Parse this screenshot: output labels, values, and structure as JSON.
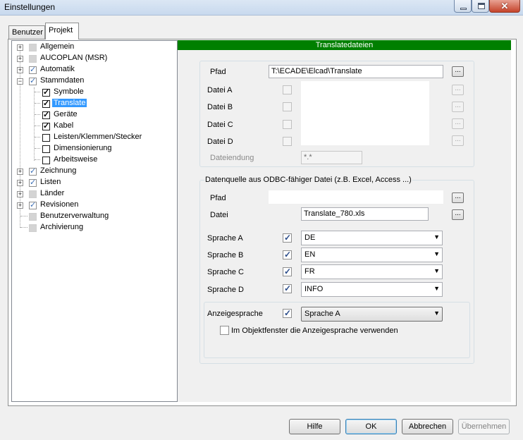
{
  "window": {
    "title": "Einstellungen",
    "close_glyph": "✕"
  },
  "tabs": [
    {
      "label": "Benutzer"
    },
    {
      "label": "Projekt"
    }
  ],
  "tree": {
    "expander_glyph": "+",
    "items": [
      {
        "label": "Allgemein"
      },
      {
        "label": "AUCOPLAN (MSR)"
      },
      {
        "label": "Automatik"
      },
      {
        "label": "Stammdaten"
      },
      {
        "label": "Symbole"
      },
      {
        "label": "Translate"
      },
      {
        "label": "Geräte"
      },
      {
        "label": "Kabel"
      },
      {
        "label": "Leisten/Klemmen/Stecker"
      },
      {
        "label": "Dimensionierung"
      },
      {
        "label": "Arbeitsweise"
      },
      {
        "label": "Zeichnung"
      },
      {
        "label": "Listen"
      },
      {
        "label": "Länder"
      },
      {
        "label": "Revisionen"
      },
      {
        "label": "Benutzerverwaltung"
      },
      {
        "label": "Archivierung"
      }
    ]
  },
  "translate": {
    "header": "Translatedateien",
    "pfad_label": "Pfad",
    "pfad_value": "T:\\ECADE\\Elcad\\Translate",
    "browse": "...",
    "datei_a": "Datei A",
    "datei_b": "Datei B",
    "datei_c": "Datei C",
    "datei_d": "Datei D",
    "dateiendung_label": "Dateiendung",
    "dateiendung_value": "*.*"
  },
  "odbc": {
    "group_title": "Datenquelle aus ODBC-fähiger Datei (z.B. Excel, Access ...)",
    "pfad_label": "Pfad",
    "pfad_value": "",
    "datei_label": "Datei",
    "datei_value": "Translate_780.xls",
    "languages": [
      {
        "label": "Sprache A",
        "value": "DE"
      },
      {
        "label": "Sprache B",
        "value": "EN"
      },
      {
        "label": "Sprache C",
        "value": "FR"
      },
      {
        "label": "Sprache D",
        "value": "INFO"
      }
    ],
    "anzeige_label": "Anzeigesprache",
    "anzeige_value": "Sprache A",
    "objektfenster_label": "Im Objektfenster die Anzeigesprache verwenden",
    "arrow_glyph": "▼"
  },
  "buttons": {
    "hilfe": "Hilfe",
    "ok": "OK",
    "abbrechen": "Abbrechen",
    "uebernehmen": "Übernehmen"
  }
}
